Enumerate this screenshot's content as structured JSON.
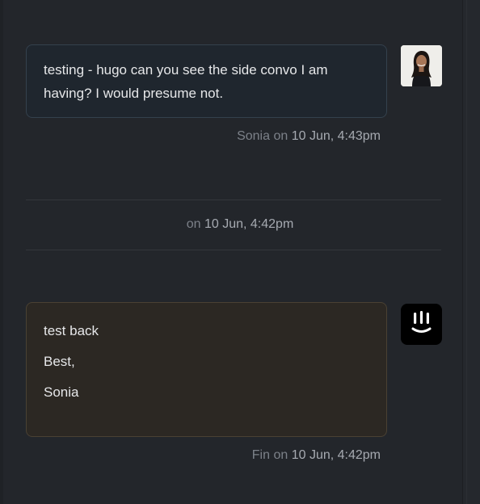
{
  "messages": [
    {
      "text": "testing - hugo can you see the side convo I am having? I would presume not.",
      "author": "Sonia",
      "on": "on",
      "time": "10 Jun, 4:43pm",
      "avatar_icon": "user-avatar-photo"
    },
    {
      "lines": [
        "test back",
        "Best,",
        "Sonia"
      ],
      "author": "Fin",
      "on": "on",
      "time": "10 Jun, 4:42pm",
      "avatar_icon": "fin-bot-logo-icon"
    }
  ],
  "separator": {
    "on": "on",
    "time": "10 Jun, 4:42pm"
  },
  "colors": {
    "background": "#23262b",
    "note_bubble": "#1f262e",
    "reply_bubble": "#2c2823",
    "meta_text": "#7c8189"
  }
}
